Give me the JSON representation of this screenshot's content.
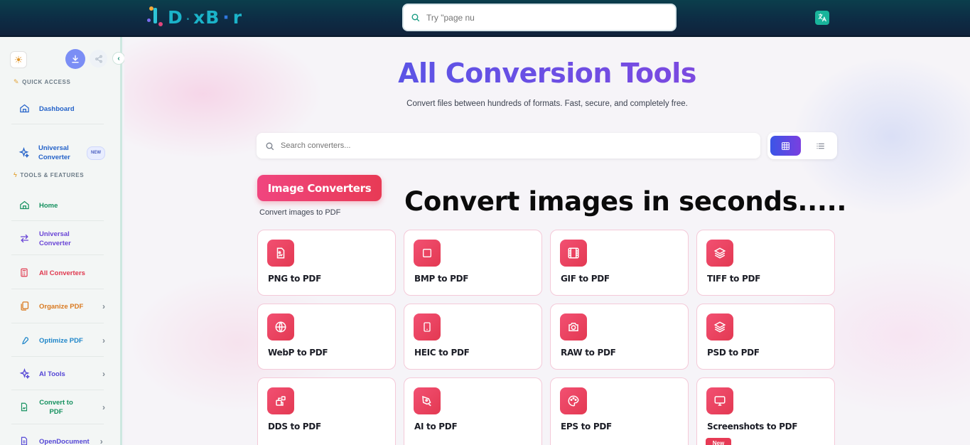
{
  "header": {
    "logo_text_1": "D",
    "logo_text_2": "xB",
    "logo_text_3": "r",
    "search": {
      "value": "",
      "placeholder": "Try \"page nu"
    },
    "translate_icon": "translate-icon"
  },
  "sidebar": {
    "quick_access_label": "QUICK ACCESS",
    "tools_label": "TOOLS & FEATURES",
    "new_badge": "NEW",
    "items": [
      {
        "label": "Dashboard",
        "icon": "home-icon",
        "color": "#2563c9"
      },
      {
        "label": "Universal Converter",
        "icon": "sparkle-icon",
        "color": "#2563c9",
        "badge": "NEW"
      },
      {
        "label": "Home",
        "icon": "home-icon",
        "color": "#15915f"
      },
      {
        "label": "Universal Converter",
        "icon": "swap-arrows-icon",
        "color": "#6a46d6"
      },
      {
        "label": "All Converters",
        "icon": "calculator-icon",
        "color": "#e0394f"
      },
      {
        "label": "Organize PDF",
        "icon": "files-icon",
        "color": "#d9791f"
      },
      {
        "label": "Optimize PDF",
        "icon": "wrench-icon",
        "color": "#1f86c9"
      },
      {
        "label": "AI Tools",
        "icon": "sparkle-icon",
        "color": "#5446d6"
      },
      {
        "label": "Convert to PDF",
        "icon": "file-image-icon",
        "color": "#15915f"
      },
      {
        "label": "OpenDocument",
        "icon": "document-icon",
        "color": "#5446d6"
      }
    ]
  },
  "main": {
    "title": "All Conversion Tools",
    "subtitle": "Convert files between hundreds of formats. Fast, secure, and completely free.",
    "search": {
      "value": "",
      "placeholder": "Search converters..."
    },
    "view_toggle": {
      "selected": "grid"
    },
    "category": {
      "title": "Image Converters",
      "description": "Convert images to PDF"
    },
    "overlay_text": "Convert images in seconds.....",
    "cards": [
      {
        "label": "PNG to PDF",
        "icon": "file-image-icon"
      },
      {
        "label": "BMP to PDF",
        "icon": "square-icon"
      },
      {
        "label": "GIF to PDF",
        "icon": "film-icon"
      },
      {
        "label": "TIFF to PDF",
        "icon": "layers-icon"
      },
      {
        "label": "WebP to PDF",
        "icon": "globe-icon"
      },
      {
        "label": "HEIC to PDF",
        "icon": "smartphone-icon"
      },
      {
        "label": "RAW to PDF",
        "icon": "camera-icon"
      },
      {
        "label": "PSD to PDF",
        "icon": "layers-icon"
      },
      {
        "label": "DDS to PDF",
        "icon": "grid-blocks-icon"
      },
      {
        "label": "AI to PDF",
        "icon": "pen-tool-icon"
      },
      {
        "label": "EPS to PDF",
        "icon": "palette-icon"
      },
      {
        "label": "Screenshots to PDF",
        "icon": "monitor-icon",
        "badge": "New"
      }
    ]
  }
}
